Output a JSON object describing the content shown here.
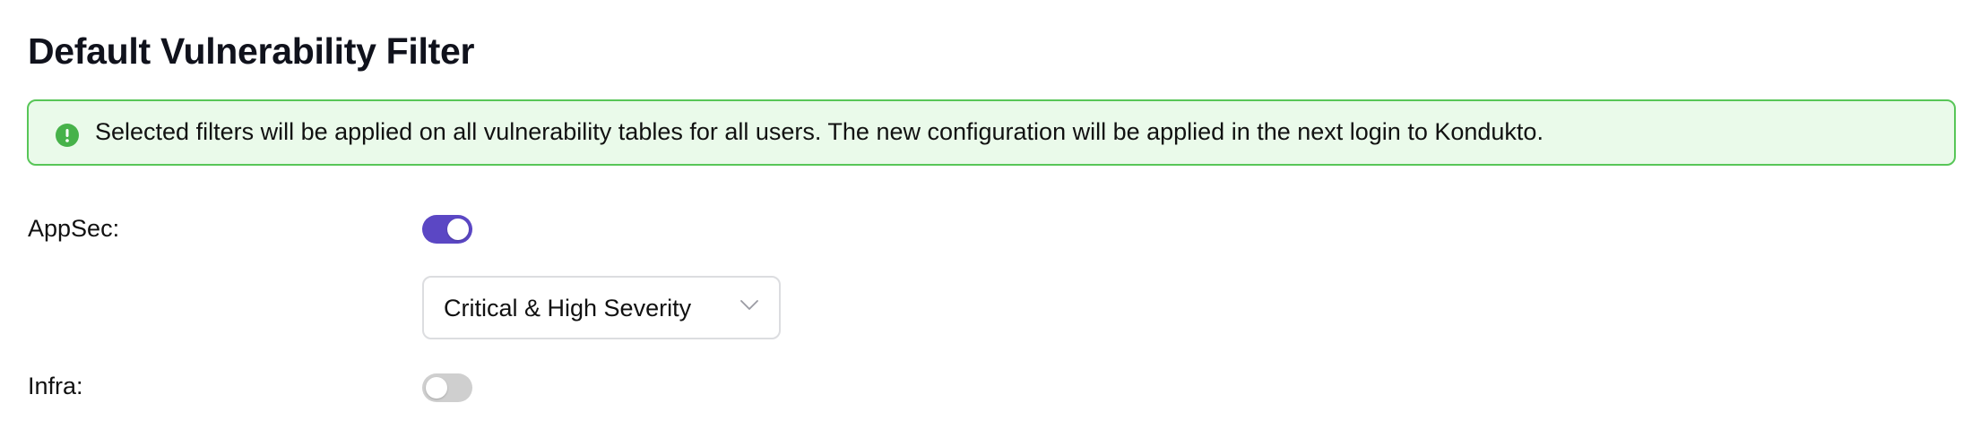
{
  "page": {
    "title": "Default Vulnerability Filter"
  },
  "banner": {
    "icon": "info-icon",
    "message": "Selected filters will be applied on all vulnerability tables for all users. The new configuration will be applied in the next login to Kondukto.",
    "colors": {
      "border": "#58c658",
      "background": "#eafaea",
      "icon": "#47b24a"
    }
  },
  "settings": {
    "appsec": {
      "label": "AppSec:",
      "enabled": true,
      "filter": {
        "selected": "Critical & High Severity",
        "icon": "chevron-down-icon"
      }
    },
    "infra": {
      "label": "Infra:",
      "enabled": false
    }
  },
  "colors": {
    "toggle_on": "#5b47c4",
    "toggle_off": "#cfcfcf"
  }
}
